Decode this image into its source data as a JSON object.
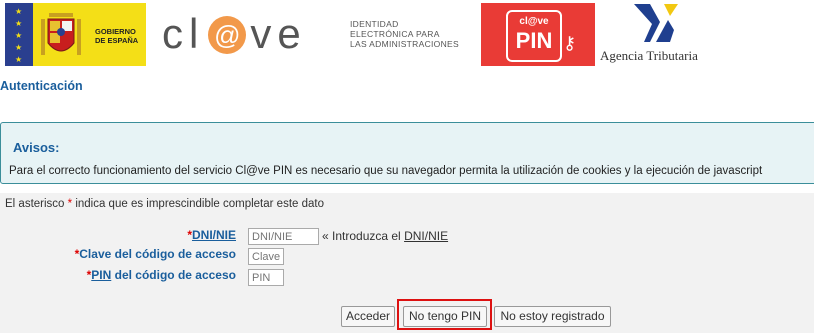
{
  "header": {
    "gobierno": {
      "line1": "GOBIERNO",
      "line2": "DE ESPAÑA"
    },
    "clave": {
      "brand_pre": "cl",
      "brand_at": "@",
      "brand_post": "ve",
      "sub1": "IDENTIDAD",
      "sub2": "ELECTRÓNICA PARA",
      "sub3": "LAS ADMINISTRACIONES"
    },
    "pin_logo": {
      "top": "cl@ve",
      "big": "PIN"
    },
    "agencia": "Agencia Tributaria"
  },
  "page_title": "Autenticación",
  "avisos": {
    "title": "Avisos:",
    "text": "Para el correcto funcionamiento del servicio Cl@ve PIN es necesario que su navegador permita la utilización de cookies y la ejecución de javascript"
  },
  "form": {
    "note_pre": "El asterisco ",
    "note_star": "*",
    "note_post": " indica que es imprescindible completar este dato",
    "dni": {
      "star": "*",
      "label": "DNI/NIE",
      "placeholder": "DNI/NIE",
      "hint_pre": "« Introduzca el ",
      "hint_link": "DNI/NIE"
    },
    "clave": {
      "star": "*",
      "label": "Clave del código de acceso",
      "placeholder": "Clave"
    },
    "pin": {
      "star": "*",
      "label_link": "PIN",
      "label_rest": " del código de acceso",
      "placeholder": "PIN"
    }
  },
  "buttons": {
    "acceder": "Acceder",
    "no_pin": "No tengo PIN",
    "no_registrado": "No estoy registrado"
  },
  "colors": {
    "accent": "#1a5e9c",
    "highlight": "#d11111",
    "pin_brand": "#e93b36"
  }
}
